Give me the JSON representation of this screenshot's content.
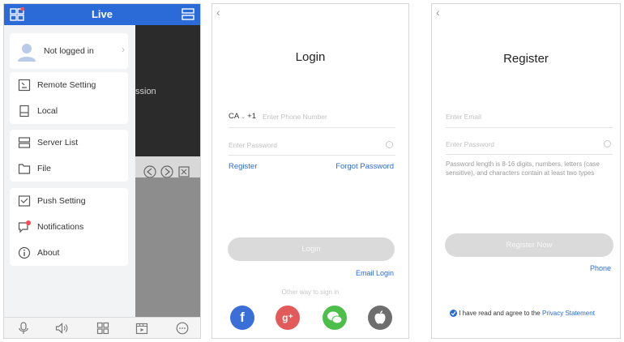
{
  "live_screen": {
    "title": "Live",
    "user": {
      "label": "Not logged in"
    },
    "background_text": "ssion",
    "menu_groups": [
      [
        {
          "label": "Remote Setting",
          "icon": "remote-setting-icon"
        },
        {
          "label": "Local",
          "icon": "local-device-icon"
        }
      ],
      [
        {
          "label": "Server List",
          "icon": "server-list-icon"
        },
        {
          "label": "File",
          "icon": "file-icon"
        }
      ],
      [
        {
          "label": "Push Setting",
          "icon": "push-setting-icon"
        },
        {
          "label": "Notifications",
          "icon": "notifications-icon"
        },
        {
          "label": "About",
          "icon": "about-icon"
        }
      ]
    ],
    "bottom_icons": [
      "microphone-icon",
      "speaker-icon",
      "grid-layout-icon",
      "playback-icon",
      "more-icon"
    ]
  },
  "login_screen": {
    "title": "Login",
    "country_code": "CA",
    "dial_code": "+1",
    "phone_placeholder": "Enter Phone Number",
    "password_placeholder": "Enter Password",
    "register_link": "Register",
    "forgot_password_link": "Forgot Password",
    "login_button": "Login",
    "email_login_link": "Email Login",
    "other_ways_label": "Other way to sign in",
    "social": [
      {
        "name": "facebook",
        "glyph": "f",
        "color": "#3b6fd8"
      },
      {
        "name": "google-plus",
        "glyph": "g⁺",
        "color": "#e35a5a"
      },
      {
        "name": "wechat",
        "glyph": "●",
        "color": "#4cbf4a"
      },
      {
        "name": "apple",
        "glyph": "",
        "color": "#6e6e6e"
      }
    ]
  },
  "register_screen": {
    "title": "Register",
    "email_placeholder": "Enter Email",
    "password_placeholder": "Enter Password",
    "password_hint": "Password length is 8-16 digits, numbers, letters (case sensitive), and characters contain at least two types",
    "register_button": "Register Now",
    "phone_link": "Phone",
    "agree_text": "I have read and agree to the",
    "privacy_link": "Privacy Statement"
  },
  "colors": {
    "accent": "#2a6bd8",
    "button_disabled": "#dadada"
  }
}
